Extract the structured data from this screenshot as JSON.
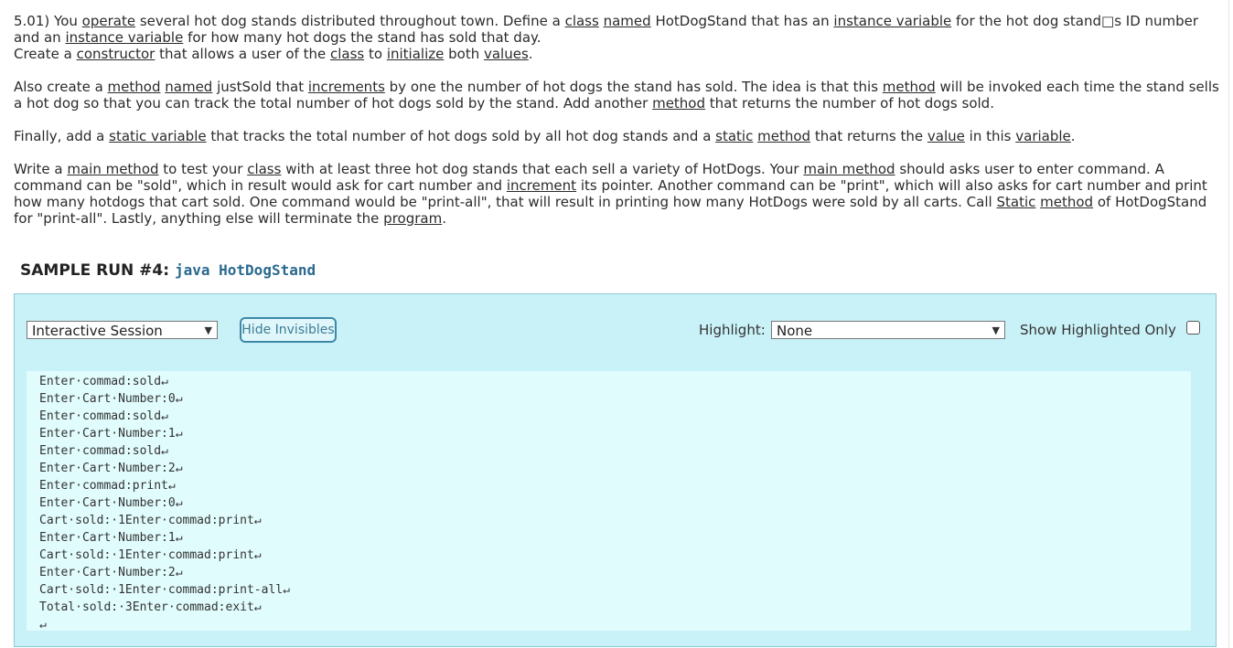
{
  "problem": {
    "p1": [
      {
        "t": "5.01) You "
      },
      {
        "t": "operate",
        "u": true
      },
      {
        "t": " several hot dog stands distributed throughout town. Define a "
      },
      {
        "t": "class",
        "u": true
      },
      {
        "t": " "
      },
      {
        "t": "named",
        "u": true
      },
      {
        "t": " HotDogStand that has an "
      },
      {
        "t": "instance variable",
        "u": true
      },
      {
        "t": " for the hot dog stand□s ID number and an "
      },
      {
        "t": "instance variable",
        "u": true
      },
      {
        "t": " for how many hot dogs the stand has sold that day."
      },
      {
        "br": true
      },
      {
        "t": "Create a "
      },
      {
        "t": "constructor",
        "u": true
      },
      {
        "t": " that allows a user of the "
      },
      {
        "t": "class",
        "u": true
      },
      {
        "t": " to "
      },
      {
        "t": "initialize",
        "u": true
      },
      {
        "t": " both "
      },
      {
        "t": "values",
        "u": true
      },
      {
        "t": "."
      }
    ],
    "p2": [
      {
        "t": "Also create a "
      },
      {
        "t": "method",
        "u": true
      },
      {
        "t": " "
      },
      {
        "t": "named",
        "u": true
      },
      {
        "t": " justSold that "
      },
      {
        "t": "increments",
        "u": true
      },
      {
        "t": " by one the number of hot dogs the stand has sold. The idea is that this "
      },
      {
        "t": "method",
        "u": true
      },
      {
        "t": " will be invoked each time the stand sells a hot dog so that you can track the total number of hot dogs sold by the stand. Add another "
      },
      {
        "t": "method",
        "u": true
      },
      {
        "t": " that returns the number of hot dogs sold."
      }
    ],
    "p3": [
      {
        "t": "Finally, add a "
      },
      {
        "t": "static variable",
        "u": true
      },
      {
        "t": " that tracks the total number of hot dogs sold by all hot dog stands and a "
      },
      {
        "t": "static",
        "u": true
      },
      {
        "t": " "
      },
      {
        "t": "method",
        "u": true
      },
      {
        "t": " that returns the "
      },
      {
        "t": "value",
        "u": true
      },
      {
        "t": " in this "
      },
      {
        "t": "variable",
        "u": true
      },
      {
        "t": "."
      }
    ],
    "p4": [
      {
        "t": "Write a "
      },
      {
        "t": "main method",
        "u": true
      },
      {
        "t": " to test your "
      },
      {
        "t": "class",
        "u": true
      },
      {
        "t": " with at least three hot dog stands that each sell a variety of HotDogs. Your "
      },
      {
        "t": "main method",
        "u": true
      },
      {
        "t": " should asks user to enter command. A command can be \"sold\", which in result would ask for cart number and "
      },
      {
        "t": "increment",
        "u": true
      },
      {
        "t": " its pointer. Another command can be \"print\", which will also asks for cart number and print how many hotdogs that cart sold. One command would be \"print-all\", that will result in printing how many HotDogs were sold by all carts. Call "
      },
      {
        "t": "Static",
        "u": true
      },
      {
        "t": " "
      },
      {
        "t": "method",
        "u": true
      },
      {
        "t": " of HotDogStand for \"print-all\". Lastly, anything else will terminate the "
      },
      {
        "t": "program",
        "u": true
      },
      {
        "t": "."
      }
    ]
  },
  "sample": {
    "title": "SAMPLE RUN #4:",
    "command": "java HotDogStand"
  },
  "toolbar": {
    "session_value": "Interactive Session",
    "hide_invisibles_label": "Hide Invisibles",
    "highlight_label": "Highlight:",
    "highlight_value": "None",
    "show_highlighted_label": "Show Highlighted Only"
  },
  "console": {
    "lines": [
      "Enter·commad:sold↵",
      "Enter·Cart·Number:0↵",
      "Enter·commad:sold↵",
      "Enter·Cart·Number:1↵",
      "Enter·commad:sold↵",
      "Enter·Cart·Number:2↵",
      "Enter·commad:print↵",
      "Enter·Cart·Number:0↵",
      "Cart·sold:·1Enter·commad:print↵",
      "Enter·Cart·Number:1↵",
      "Cart·sold:·1Enter·commad:print↵",
      "Enter·Cart·Number:2↵",
      "Cart·sold:·1Enter·commad:print-all↵",
      "Total·sold:·3Enter·commad:exit↵",
      "↵"
    ]
  }
}
